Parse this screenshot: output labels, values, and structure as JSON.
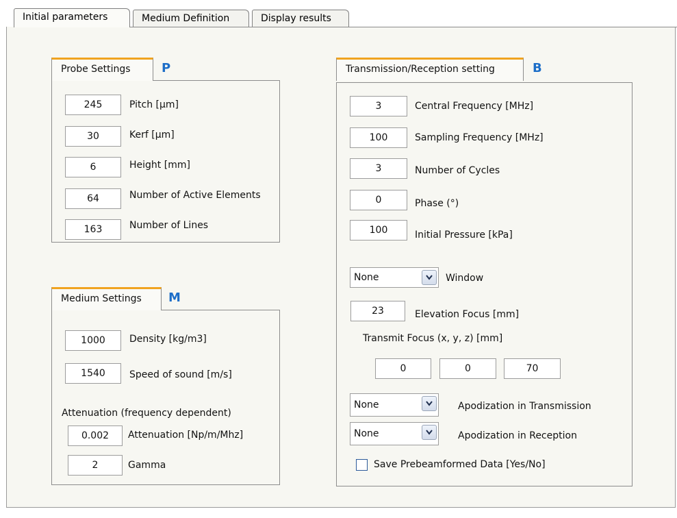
{
  "tabs": [
    "Initial parameters",
    "Medium Definition",
    "Display results"
  ],
  "probe": {
    "title": "Probe Settings",
    "letter": "P",
    "fields": [
      {
        "value": "245",
        "label": "Pitch [µm]"
      },
      {
        "value": "30",
        "label": "Kerf [µm]"
      },
      {
        "value": "6",
        "label": "Height [mm]"
      },
      {
        "value": "64",
        "label": "Number of Active Elements"
      },
      {
        "value": "163",
        "label": "Number of Lines"
      }
    ]
  },
  "medium": {
    "title": "Medium Settings",
    "letter": "M",
    "fields": [
      {
        "value": "1000",
        "label": "Density [kg/m3]"
      },
      {
        "value": "1540",
        "label": "Speed of sound [m/s]"
      }
    ],
    "attenuation_heading": "Attenuation (frequency dependent)",
    "att_fields": [
      {
        "value": "0.002",
        "label": "Attenuation [Np/m/Mhz]"
      },
      {
        "value": "2",
        "label": "Gamma"
      }
    ]
  },
  "transmission": {
    "title": "Transmission/Reception setting",
    "letter": "B",
    "fields": [
      {
        "value": "3",
        "label": "Central Frequency [MHz]"
      },
      {
        "value": "100",
        "label": "Sampling Frequency [MHz]"
      },
      {
        "value": "3",
        "label": "Number of Cycles"
      },
      {
        "value": "0",
        "label": "Phase (°)"
      },
      {
        "value": "100",
        "label": "Initial Pressure [kPa]"
      }
    ],
    "window": {
      "value": "None",
      "label": "Window"
    },
    "elevation": {
      "value": "23",
      "label": "Elevation Focus [mm]"
    },
    "transmit_focus_label": "Transmit Focus (x, y, z) [mm]",
    "transmit_focus": [
      "0",
      "0",
      "70"
    ],
    "apod_tx": {
      "value": "None",
      "label": "Apodization in Transmission"
    },
    "apod_rx": {
      "value": "None",
      "label": "Apodization in Reception"
    },
    "save_prebeam": {
      "label": "Save Prebeamformed Data [Yes/No]",
      "checked": false
    }
  },
  "colors": {
    "accent": "#f0a320",
    "letters": "#1d6ec8"
  }
}
